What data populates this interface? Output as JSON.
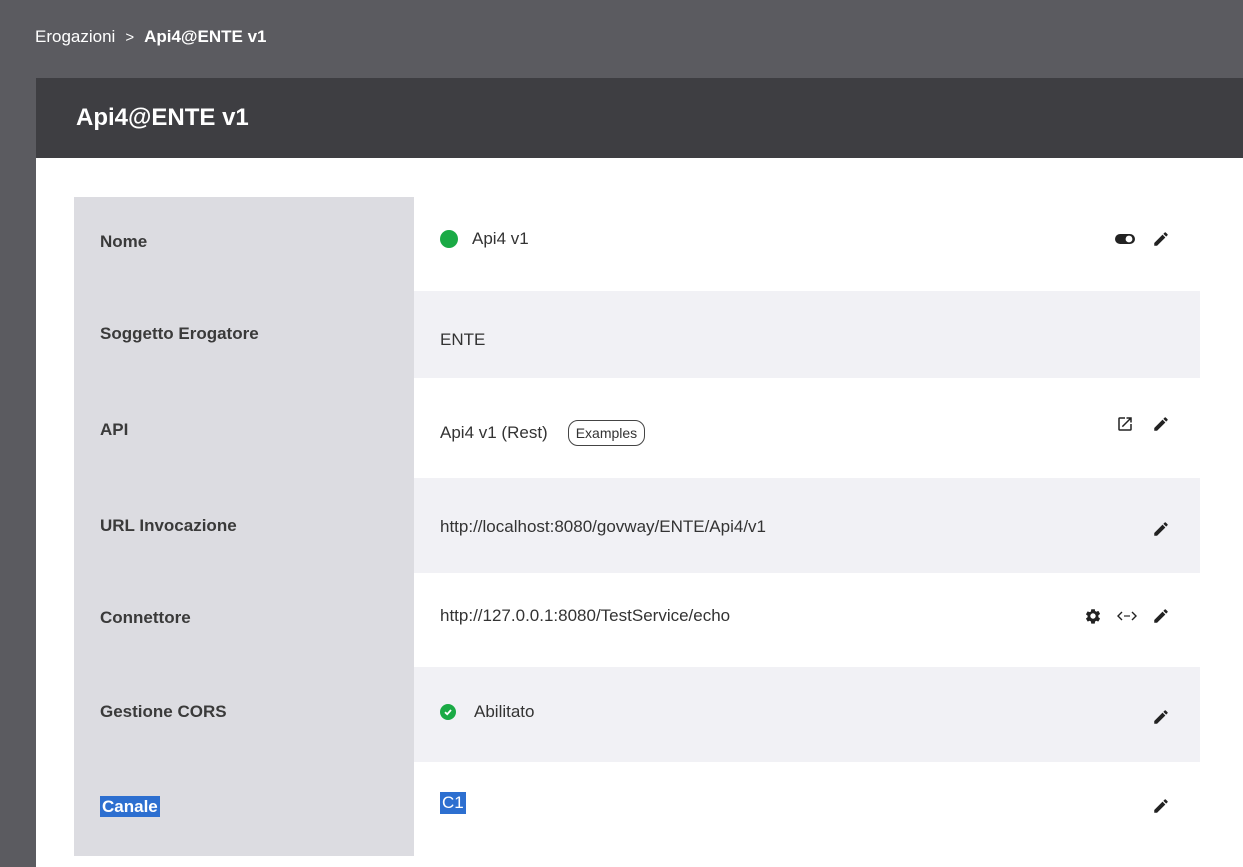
{
  "breadcrumb": {
    "parent": "Erogazioni",
    "separator": ">",
    "current": "Api4@ENTE v1"
  },
  "page": {
    "title": "Api4@ENTE v1"
  },
  "rows": [
    {
      "label": "Nome",
      "value": "Api4 v1",
      "status_color": "#1aaa45"
    },
    {
      "label": "Soggetto Erogatore",
      "value": "ENTE"
    },
    {
      "label": "API",
      "value": "Api4 v1 (Rest)",
      "chip": "Examples"
    },
    {
      "label": "URL Invocazione",
      "value": "http://localhost:8080/govway/ENTE/Api4/v1"
    },
    {
      "label": "Connettore",
      "value": "http://127.0.0.1:8080/TestService/echo"
    },
    {
      "label": "Gestione CORS",
      "value": "Abilitato"
    },
    {
      "label": "Canale",
      "value": "C1"
    }
  ],
  "icons": {
    "toggle": "toggle-icon",
    "edit": "pencil-icon",
    "open": "open-in-new-icon",
    "settings": "gear-icon",
    "code": "code-icon",
    "check": "check-circle-icon"
  },
  "colors": {
    "header_bg": "#3e3e42",
    "label_bg": "#dcdce1",
    "alt_row_bg": "#f1f1f5",
    "success": "#1aaa45",
    "selection": "#2d6fd0"
  }
}
